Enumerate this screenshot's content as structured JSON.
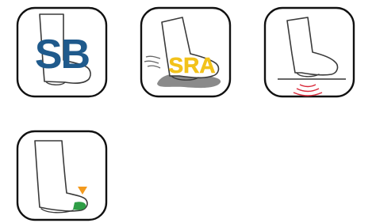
{
  "badges": [
    {
      "text": "SB",
      "text_color": "#1f5a8c",
      "icon": "sb-boot-icon"
    },
    {
      "text": "SRA",
      "text_color": "#f2c21b",
      "icon": "sra-slip-resistance-icon"
    },
    {
      "text": "",
      "icon": "antistatic-boot-icon",
      "accent_color": "#d9293a"
    },
    {
      "text": "",
      "icon": "toe-cap-boot-icon",
      "accent_colors": [
        "#f39a1e",
        "#2e9e46"
      ]
    }
  ]
}
